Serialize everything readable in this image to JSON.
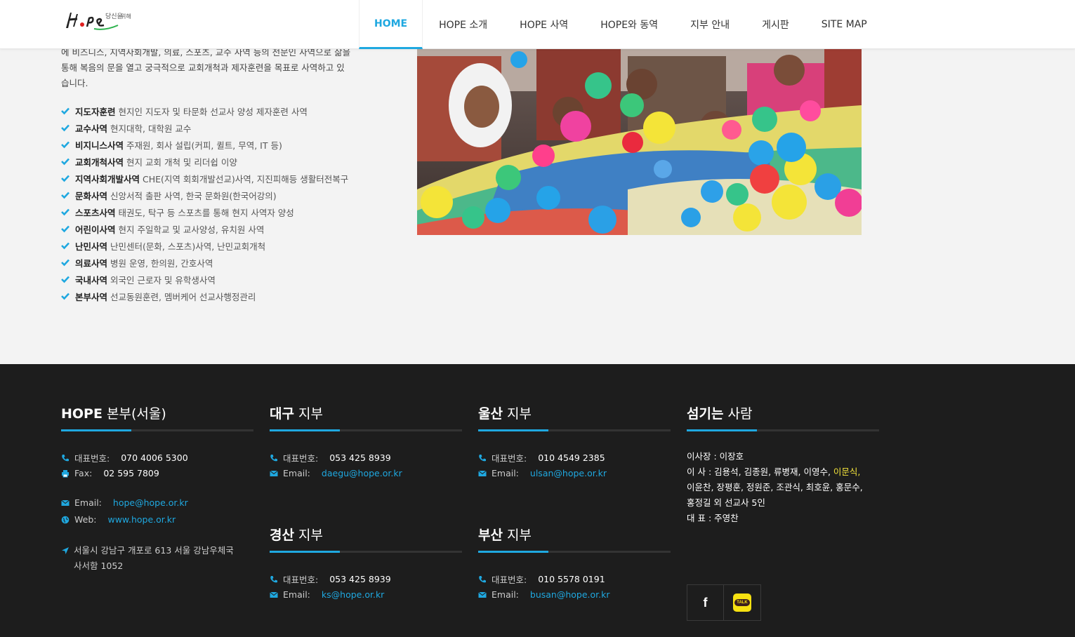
{
  "header": {
    "nav": [
      "HOME",
      "HOPE 소개",
      "HOPE 사역",
      "HOPE와 동역",
      "지부 안내",
      "게시판",
      "SITE MAP"
    ]
  },
  "intro": {
    "line1": "에 비즈니스, 지역사회개발, 의료, 스포츠, 교수 사역 등의 전문인 사역으로 삶을",
    "line2": "통해 복음의 문을 열고 궁극적으로 교회개척과 제자훈련을 목표로 사역하고 있",
    "line3": "습니다."
  },
  "ministries": [
    {
      "title": "지도자훈련",
      "desc": "현지인 지도자 및 타문화 선교사 양성 제자훈련 사역"
    },
    {
      "title": "교수사역",
      "desc": "현지대학, 대학원 교수"
    },
    {
      "title": "비지니스사역",
      "desc": "주재원, 회사 설립(커피, 퀼트, 무역, IT 등)"
    },
    {
      "title": "교회개척사역",
      "desc": "현지 교회 개척 및 리더쉽 이양"
    },
    {
      "title": "지역사회개발사역",
      "desc": "CHE(지역 회회개발선교)사역, 지진피해등 생활터전복구"
    },
    {
      "title": "문화사역",
      "desc": "신앙서적 출판 사역, 한국 문화원(한국어강의)"
    },
    {
      "title": "스포츠사역",
      "desc": "태권도, 탁구 등 스포츠를 통해 현지 사역자 양성"
    },
    {
      "title": "어린이사역",
      "desc": "현지 주일학교 및 교사양성, 유치원 사역"
    },
    {
      "title": "난민사역",
      "desc": "난민센터(문화, 스포츠)사역, 난민교회개척"
    },
    {
      "title": "의료사역",
      "desc": "병원 운영, 한의원, 간호사역"
    },
    {
      "title": "국내사역",
      "desc": "외국인 근로자 및 유학생사역"
    },
    {
      "title": "본부사역",
      "desc": "선교동원훈련, 멤버케어 선교사행정관리"
    }
  ],
  "footer": {
    "hq": {
      "title_bold": "HOPE",
      "title_rest": " 본부(서울)",
      "phone_label": "대표번호:",
      "phone": "070 4006 5300",
      "fax_label": "Fax:",
      "fax": "02 595 7809",
      "email_label": "Email:",
      "email": "hope@hope.or.kr",
      "web_label": "Web:",
      "web": "www.hope.or.kr",
      "addr1": "서울시 강남구 개포로 613 서울 강남우체국",
      "addr2": "사서함 1052"
    },
    "daegu": {
      "title_bold": "대구",
      "title_rest": " 지부",
      "phone_label": "대표번호:",
      "phone": "053 425 8939",
      "email_label": "Email:",
      "email": "daegu@hope.or.kr"
    },
    "ulsan": {
      "title_bold": "울산",
      "title_rest": " 지부",
      "phone_label": "대표번호:",
      "phone": "010 4549 2385",
      "email_label": "Email:",
      "email": "ulsan@hope.or.kr"
    },
    "gyeongsan": {
      "title_bold": "경산",
      "title_rest": " 지부",
      "phone_label": "대표번호:",
      "phone": "053 425 8939",
      "email_label": "Email:",
      "email": "ks@hope.or.kr"
    },
    "busan": {
      "title_bold": "부산",
      "title_rest": " 지부",
      "phone_label": "대표번호:",
      "phone": "010 5578 0191",
      "email_label": "Email:",
      "email": "busan@hope.or.kr"
    },
    "people": {
      "title_bold": "섬기는",
      "title_rest": " 사람",
      "chair": "이사장 : 이장호",
      "board_a": "이 사 : 김용석, 김종원, 류병재, 이영수, ",
      "board_hl": "이문식,",
      "board_b": "이윤찬, 장평훈, 정원준, 조관식, 최호윤, 홍문수,",
      "board_c": "홍정길 외 선교사 5인",
      "rep": "대 표 : 주영찬"
    },
    "social": {
      "facebook_icon": "f",
      "kakao_icon": "TALK"
    }
  },
  "colors": {
    "accent": "#1fa8e0",
    "footer_bg": "#1d1d1d",
    "highlight": "#f5e53b"
  }
}
